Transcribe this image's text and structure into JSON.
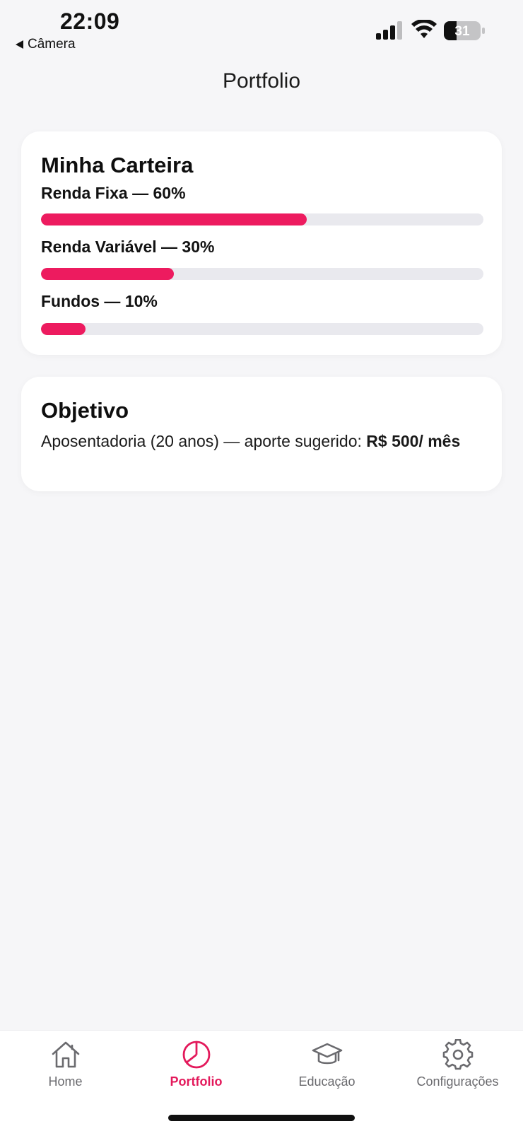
{
  "status": {
    "time": "22:09",
    "back_label": "Câmera",
    "battery": "31"
  },
  "header": {
    "title": "Portfolio"
  },
  "portfolio_card": {
    "title": "Minha Carteira",
    "allocations": [
      {
        "label": "Renda Fixa — 60%",
        "percent": 60
      },
      {
        "label": "Renda Variável — 30%",
        "percent": 30
      },
      {
        "label": "Fundos — 10%",
        "percent": 10
      }
    ]
  },
  "goal_card": {
    "title": "Objetivo",
    "text": "Aposentadoria (20 anos) — aporte sugerido: ",
    "amount": "R$ 500/ mês"
  },
  "tabs": [
    {
      "label": "Home",
      "icon": "home-icon",
      "active": false
    },
    {
      "label": "Portfolio",
      "icon": "pie-chart-icon",
      "active": true
    },
    {
      "label": "Educação",
      "icon": "graduation-cap-icon",
      "active": false
    },
    {
      "label": "Configurações",
      "icon": "gear-icon",
      "active": false
    }
  ],
  "colors": {
    "accent": "#ED1B5F",
    "track": "#E9E9EE",
    "background": "#F6F6F8"
  }
}
